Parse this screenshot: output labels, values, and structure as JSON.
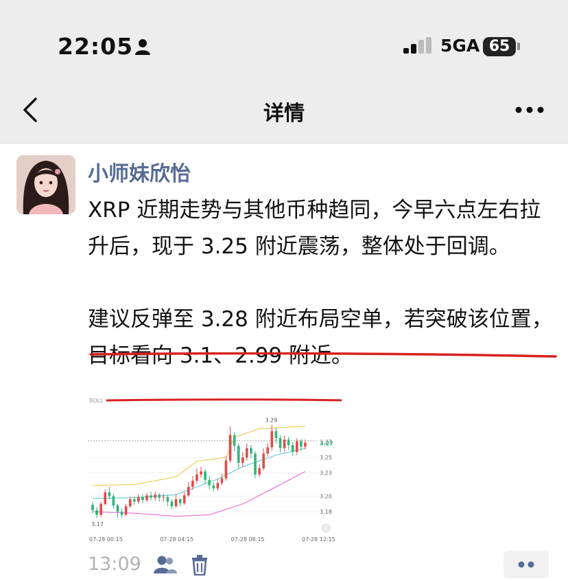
{
  "status_bar": {
    "time": "22:05",
    "network": "5GA",
    "battery": "65"
  },
  "nav": {
    "title": "详情"
  },
  "post": {
    "author": "小师妹欣怡",
    "paragraph1": "XRP 近期走势与其他币种趋同，今早六点左右拉升后，现于 3.25 附近震荡，整体处于回调。",
    "paragraph2": "建议反弹至 3.28 附近布局空单，若突破该位置，目标看向 3.1、2.99 附近。",
    "timestamp": "13:09"
  },
  "colors": {
    "accent_name": "#576b95",
    "underline": "#d92020",
    "bull": "#e14b4b",
    "bear": "#31b57c"
  },
  "chart_data": {
    "type": "candlestick",
    "indicator": "BOLL",
    "y_ticks": [
      "3.27",
      "3.25",
      "3.23",
      "3.20",
      "3.18"
    ],
    "x_ticks": [
      "07-28 00:15",
      "07-28 04:15",
      "07-28 08:15",
      "07-28 12:15"
    ],
    "current_price": "3.27",
    "current_price_overlay": "3.27",
    "high_label": "3.29",
    "low_label": "3.17",
    "ylim": [
      3.165,
      3.305
    ],
    "candles": [
      [
        3.189,
        3.182,
        3.193,
        3.178
      ],
      [
        3.182,
        3.176,
        3.186,
        3.172
      ],
      [
        3.176,
        3.19,
        3.193,
        3.173
      ],
      [
        3.19,
        3.205,
        3.209,
        3.188
      ],
      [
        3.205,
        3.2,
        3.212,
        3.196
      ],
      [
        3.2,
        3.188,
        3.203,
        3.184
      ],
      [
        3.188,
        3.18,
        3.19,
        3.172
      ],
      [
        3.18,
        3.176,
        3.184,
        3.172
      ],
      [
        3.176,
        3.187,
        3.19,
        3.174
      ],
      [
        3.187,
        3.196,
        3.199,
        3.185
      ],
      [
        3.196,
        3.193,
        3.2,
        3.189
      ],
      [
        3.193,
        3.199,
        3.203,
        3.19
      ],
      [
        3.199,
        3.195,
        3.202,
        3.191
      ],
      [
        3.195,
        3.201,
        3.204,
        3.192
      ],
      [
        3.201,
        3.198,
        3.206,
        3.195
      ],
      [
        3.198,
        3.202,
        3.206,
        3.194
      ],
      [
        3.202,
        3.198,
        3.204,
        3.193
      ],
      [
        3.198,
        3.199,
        3.203,
        3.193
      ],
      [
        3.199,
        3.193,
        3.202,
        3.187
      ],
      [
        3.193,
        3.187,
        3.196,
        3.183
      ],
      [
        3.187,
        3.196,
        3.202,
        3.185
      ],
      [
        3.196,
        3.191,
        3.198,
        3.187
      ],
      [
        3.191,
        3.201,
        3.205,
        3.189
      ],
      [
        3.201,
        3.212,
        3.218,
        3.199
      ],
      [
        3.212,
        3.22,
        3.226,
        3.208
      ],
      [
        3.22,
        3.228,
        3.236,
        3.216
      ],
      [
        3.228,
        3.232,
        3.238,
        3.224
      ],
      [
        3.232,
        3.221,
        3.235,
        3.216
      ],
      [
        3.221,
        3.214,
        3.226,
        3.209
      ],
      [
        3.214,
        3.21,
        3.218,
        3.206
      ],
      [
        3.21,
        3.217,
        3.222,
        3.207
      ],
      [
        3.217,
        3.223,
        3.229,
        3.214
      ],
      [
        3.223,
        3.246,
        3.252,
        3.22
      ],
      [
        3.246,
        3.279,
        3.29,
        3.243
      ],
      [
        3.279,
        3.265,
        3.283,
        3.258
      ],
      [
        3.265,
        3.243,
        3.268,
        3.236
      ],
      [
        3.243,
        3.25,
        3.257,
        3.238
      ],
      [
        3.25,
        3.262,
        3.268,
        3.246
      ],
      [
        3.262,
        3.255,
        3.266,
        3.249
      ],
      [
        3.255,
        3.228,
        3.258,
        3.223
      ],
      [
        3.228,
        3.236,
        3.241,
        3.225
      ],
      [
        3.236,
        3.255,
        3.262,
        3.233
      ],
      [
        3.255,
        3.263,
        3.268,
        3.251
      ],
      [
        3.263,
        3.284,
        3.292,
        3.259
      ],
      [
        3.284,
        3.275,
        3.288,
        3.268
      ],
      [
        3.275,
        3.262,
        3.279,
        3.256
      ],
      [
        3.262,
        3.273,
        3.278,
        3.257
      ],
      [
        3.273,
        3.266,
        3.277,
        3.26
      ],
      [
        3.266,
        3.257,
        3.27,
        3.252
      ],
      [
        3.257,
        3.271,
        3.275,
        3.253
      ],
      [
        3.271,
        3.264,
        3.274,
        3.258
      ],
      [
        3.264,
        3.269,
        3.273,
        3.26
      ]
    ],
    "boll_upper": [
      [
        0,
        3.214
      ],
      [
        10,
        3.215
      ],
      [
        20,
        3.225
      ],
      [
        25,
        3.245
      ],
      [
        32,
        3.25
      ],
      [
        34,
        3.276
      ],
      [
        40,
        3.287
      ],
      [
        51,
        3.29
      ]
    ],
    "boll_mid": [
      [
        0,
        3.197
      ],
      [
        10,
        3.198
      ],
      [
        20,
        3.202
      ],
      [
        30,
        3.222
      ],
      [
        36,
        3.238
      ],
      [
        44,
        3.253
      ],
      [
        51,
        3.262
      ]
    ],
    "boll_lower": [
      [
        0,
        3.18
      ],
      [
        10,
        3.178
      ],
      [
        20,
        3.174
      ],
      [
        28,
        3.176
      ],
      [
        36,
        3.19
      ],
      [
        44,
        3.212
      ],
      [
        51,
        3.232
      ]
    ]
  }
}
